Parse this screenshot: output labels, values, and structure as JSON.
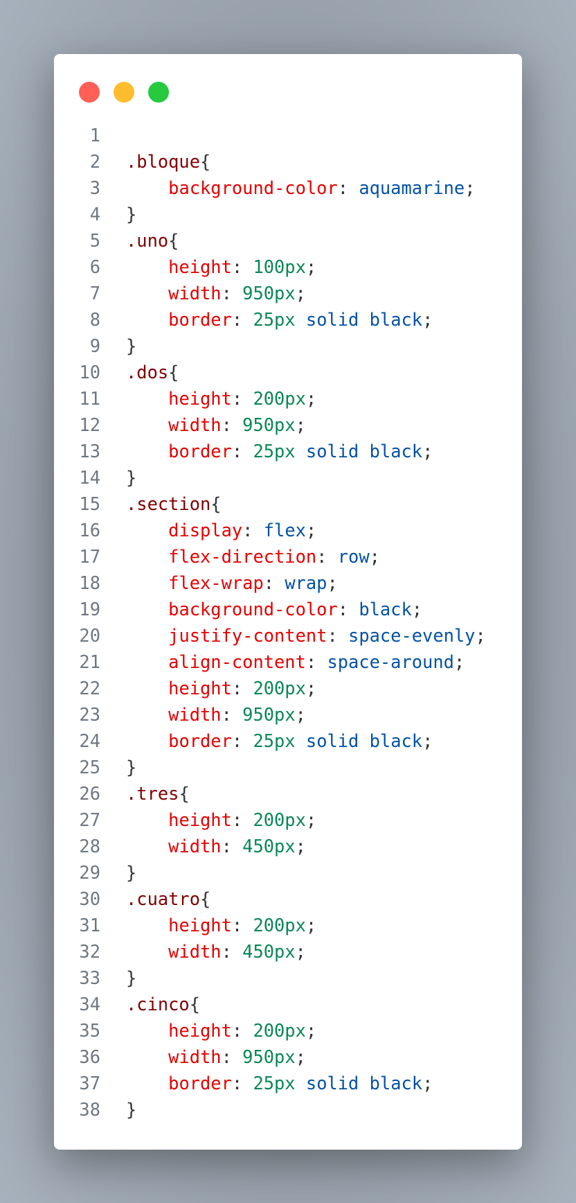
{
  "window": {
    "controls": [
      {
        "name": "close",
        "color": "#ff5f56"
      },
      {
        "name": "minimize",
        "color": "#ffbd2e"
      },
      {
        "name": "maximize",
        "color": "#27c93f"
      }
    ]
  },
  "code": [
    [],
    [
      [
        "sel",
        ".bloque"
      ],
      [
        "p",
        "{"
      ]
    ],
    [
      [
        "p",
        "    "
      ],
      [
        "prop",
        "background-color"
      ],
      [
        "p",
        ": "
      ],
      [
        "val",
        "aquamarine"
      ],
      [
        "p",
        ";"
      ]
    ],
    [
      [
        "p",
        "}"
      ]
    ],
    [
      [
        "sel",
        ".uno"
      ],
      [
        "p",
        "{"
      ]
    ],
    [
      [
        "p",
        "    "
      ],
      [
        "prop",
        "height"
      ],
      [
        "p",
        ": "
      ],
      [
        "num",
        "100px"
      ],
      [
        "p",
        ";"
      ]
    ],
    [
      [
        "p",
        "    "
      ],
      [
        "prop",
        "width"
      ],
      [
        "p",
        ": "
      ],
      [
        "num",
        "950px"
      ],
      [
        "p",
        ";"
      ]
    ],
    [
      [
        "p",
        "    "
      ],
      [
        "prop",
        "border"
      ],
      [
        "p",
        ": "
      ],
      [
        "num",
        "25px"
      ],
      [
        "p",
        " "
      ],
      [
        "val",
        "solid black"
      ],
      [
        "p",
        ";"
      ]
    ],
    [
      [
        "p",
        "}"
      ]
    ],
    [
      [
        "sel",
        ".dos"
      ],
      [
        "p",
        "{"
      ]
    ],
    [
      [
        "p",
        "    "
      ],
      [
        "prop",
        "height"
      ],
      [
        "p",
        ": "
      ],
      [
        "num",
        "200px"
      ],
      [
        "p",
        ";"
      ]
    ],
    [
      [
        "p",
        "    "
      ],
      [
        "prop",
        "width"
      ],
      [
        "p",
        ": "
      ],
      [
        "num",
        "950px"
      ],
      [
        "p",
        ";"
      ]
    ],
    [
      [
        "p",
        "    "
      ],
      [
        "prop",
        "border"
      ],
      [
        "p",
        ": "
      ],
      [
        "num",
        "25px"
      ],
      [
        "p",
        " "
      ],
      [
        "val",
        "solid black"
      ],
      [
        "p",
        ";"
      ]
    ],
    [
      [
        "p",
        "}"
      ]
    ],
    [
      [
        "sel",
        ".section"
      ],
      [
        "p",
        "{"
      ]
    ],
    [
      [
        "p",
        "    "
      ],
      [
        "prop",
        "display"
      ],
      [
        "p",
        ": "
      ],
      [
        "val",
        "flex"
      ],
      [
        "p",
        ";"
      ]
    ],
    [
      [
        "p",
        "    "
      ],
      [
        "prop",
        "flex-direction"
      ],
      [
        "p",
        ": "
      ],
      [
        "val",
        "row"
      ],
      [
        "p",
        ";"
      ]
    ],
    [
      [
        "p",
        "    "
      ],
      [
        "prop",
        "flex-wrap"
      ],
      [
        "p",
        ": "
      ],
      [
        "val",
        "wrap"
      ],
      [
        "p",
        ";"
      ]
    ],
    [
      [
        "p",
        "    "
      ],
      [
        "prop",
        "background-color"
      ],
      [
        "p",
        ": "
      ],
      [
        "val",
        "black"
      ],
      [
        "p",
        ";"
      ]
    ],
    [
      [
        "p",
        "    "
      ],
      [
        "prop",
        "justify-content"
      ],
      [
        "p",
        ": "
      ],
      [
        "val",
        "space-evenly"
      ],
      [
        "p",
        ";"
      ]
    ],
    [
      [
        "p",
        "    "
      ],
      [
        "prop",
        "align-content"
      ],
      [
        "p",
        ": "
      ],
      [
        "val",
        "space-around"
      ],
      [
        "p",
        ";"
      ]
    ],
    [
      [
        "p",
        "    "
      ],
      [
        "prop",
        "height"
      ],
      [
        "p",
        ": "
      ],
      [
        "num",
        "200px"
      ],
      [
        "p",
        ";"
      ]
    ],
    [
      [
        "p",
        "    "
      ],
      [
        "prop",
        "width"
      ],
      [
        "p",
        ": "
      ],
      [
        "num",
        "950px"
      ],
      [
        "p",
        ";"
      ]
    ],
    [
      [
        "p",
        "    "
      ],
      [
        "prop",
        "border"
      ],
      [
        "p",
        ": "
      ],
      [
        "num",
        "25px"
      ],
      [
        "p",
        " "
      ],
      [
        "val",
        "solid black"
      ],
      [
        "p",
        ";"
      ]
    ],
    [
      [
        "p",
        "}"
      ]
    ],
    [
      [
        "sel",
        ".tres"
      ],
      [
        "p",
        "{"
      ]
    ],
    [
      [
        "p",
        "    "
      ],
      [
        "prop",
        "height"
      ],
      [
        "p",
        ": "
      ],
      [
        "num",
        "200px"
      ],
      [
        "p",
        ";"
      ]
    ],
    [
      [
        "p",
        "    "
      ],
      [
        "prop",
        "width"
      ],
      [
        "p",
        ": "
      ],
      [
        "num",
        "450px"
      ],
      [
        "p",
        ";"
      ]
    ],
    [
      [
        "p",
        "}"
      ]
    ],
    [
      [
        "sel",
        ".cuatro"
      ],
      [
        "p",
        "{"
      ]
    ],
    [
      [
        "p",
        "    "
      ],
      [
        "prop",
        "height"
      ],
      [
        "p",
        ": "
      ],
      [
        "num",
        "200px"
      ],
      [
        "p",
        ";"
      ]
    ],
    [
      [
        "p",
        "    "
      ],
      [
        "prop",
        "width"
      ],
      [
        "p",
        ": "
      ],
      [
        "num",
        "450px"
      ],
      [
        "p",
        ";"
      ]
    ],
    [
      [
        "p",
        "}"
      ]
    ],
    [
      [
        "sel",
        ".cinco"
      ],
      [
        "p",
        "{"
      ]
    ],
    [
      [
        "p",
        "    "
      ],
      [
        "prop",
        "height"
      ],
      [
        "p",
        ": "
      ],
      [
        "num",
        "200px"
      ],
      [
        "p",
        ";"
      ]
    ],
    [
      [
        "p",
        "    "
      ],
      [
        "prop",
        "width"
      ],
      [
        "p",
        ": "
      ],
      [
        "num",
        "950px"
      ],
      [
        "p",
        ";"
      ]
    ],
    [
      [
        "p",
        "    "
      ],
      [
        "prop",
        "border"
      ],
      [
        "p",
        ": "
      ],
      [
        "num",
        "25px"
      ],
      [
        "p",
        " "
      ],
      [
        "val",
        "solid black"
      ],
      [
        "p",
        ";"
      ]
    ],
    [
      [
        "p",
        "}"
      ]
    ]
  ]
}
